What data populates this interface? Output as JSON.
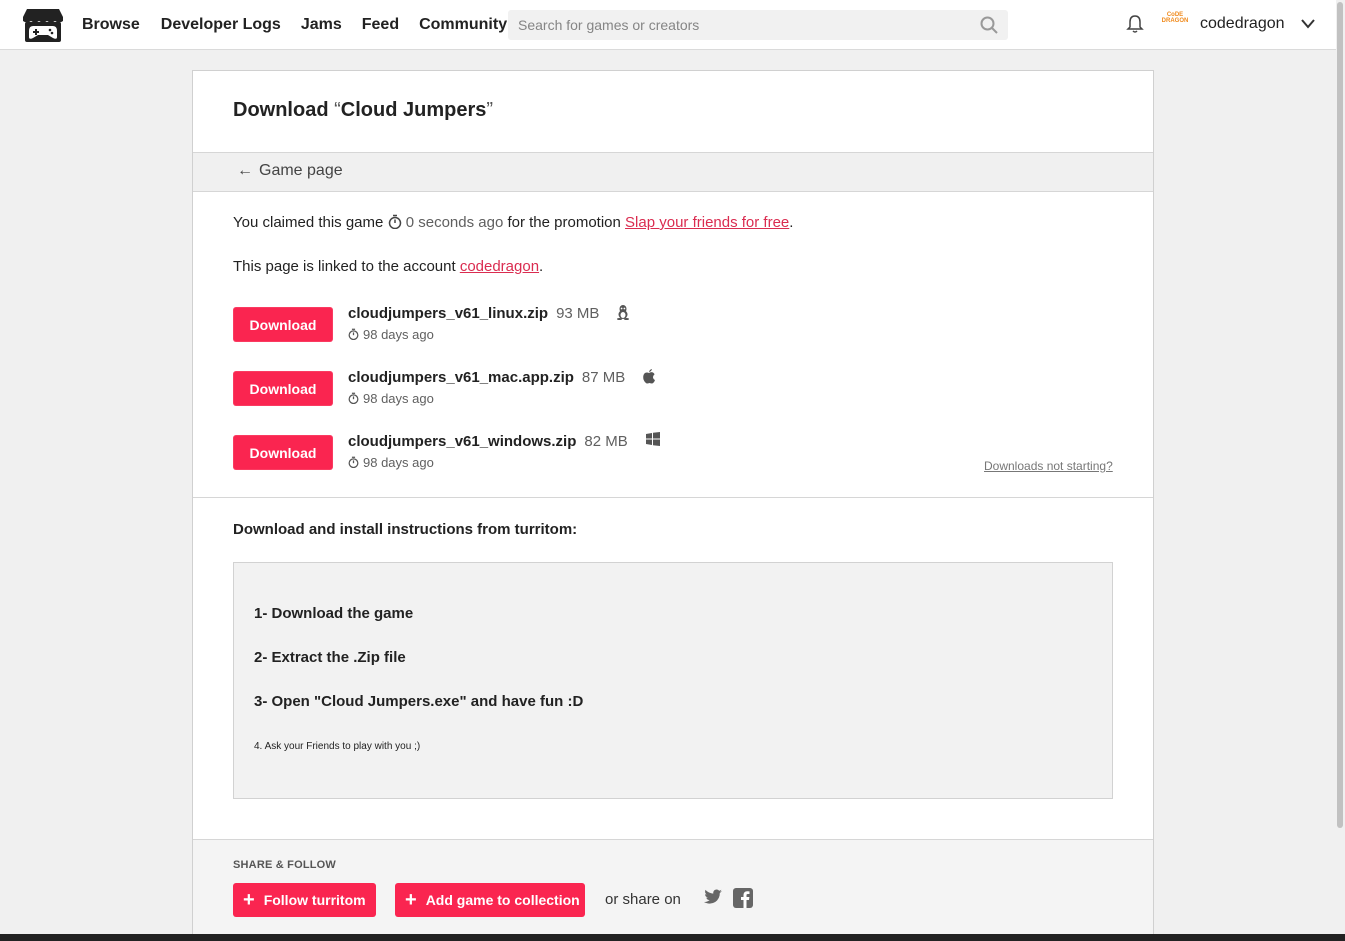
{
  "nav": {
    "items": [
      {
        "label": "Browse"
      },
      {
        "label": "Developer Logs"
      },
      {
        "label": "Jams"
      },
      {
        "label": "Feed"
      },
      {
        "label": "Community"
      }
    ],
    "search_placeholder": "Search for games or creators",
    "username": "codedragon",
    "avatar_text": "CoDE DRAGON"
  },
  "page": {
    "title_prefix": "Download ",
    "open_quote": "“",
    "game_name": "Cloud Jumpers",
    "close_quote": "”",
    "back_arrow": "←",
    "back_label": "Game page",
    "claim_prefix": "You claimed this game ",
    "claim_time": "0 seconds ago",
    "claim_mid": " for the promotion ",
    "promotion": "Slap your friends for free",
    "claim_end": ".",
    "linked_prefix": "This page is linked to the account ",
    "linked_account": "codedragon",
    "linked_end": ".",
    "downloads_not_starting": "Downloads not starting?"
  },
  "downloads": [
    {
      "button": "Download",
      "filename": "cloudjumpers_v61_linux.zip",
      "size": "93 MB",
      "os_icon": "linux-icon",
      "date": "98 days ago"
    },
    {
      "button": "Download",
      "filename": "cloudjumpers_v61_mac.app.zip",
      "size": "87 MB",
      "os_icon": "apple-icon",
      "date": "98 days ago"
    },
    {
      "button": "Download",
      "filename": "cloudjumpers_v61_windows.zip",
      "size": "82 MB",
      "os_icon": "windows-icon",
      "date": "98 days ago"
    }
  ],
  "instructions": {
    "title": "Download and install instructions from turritom:",
    "steps": [
      "1- Download the game",
      "2- Extract the .Zip file",
      "3- Open \"Cloud Jumpers.exe\" and have fun :D"
    ],
    "note": "4. Ask your Friends to play with you ;)"
  },
  "share": {
    "title": "SHARE & FOLLOW",
    "follow_label": "Follow turritom",
    "collection_label": "Add game to collection",
    "share_text": "or share on",
    "plus": "+"
  },
  "colors": {
    "accent": "#fa2550",
    "link": "#da2c50",
    "background": "#f0f0f0"
  }
}
